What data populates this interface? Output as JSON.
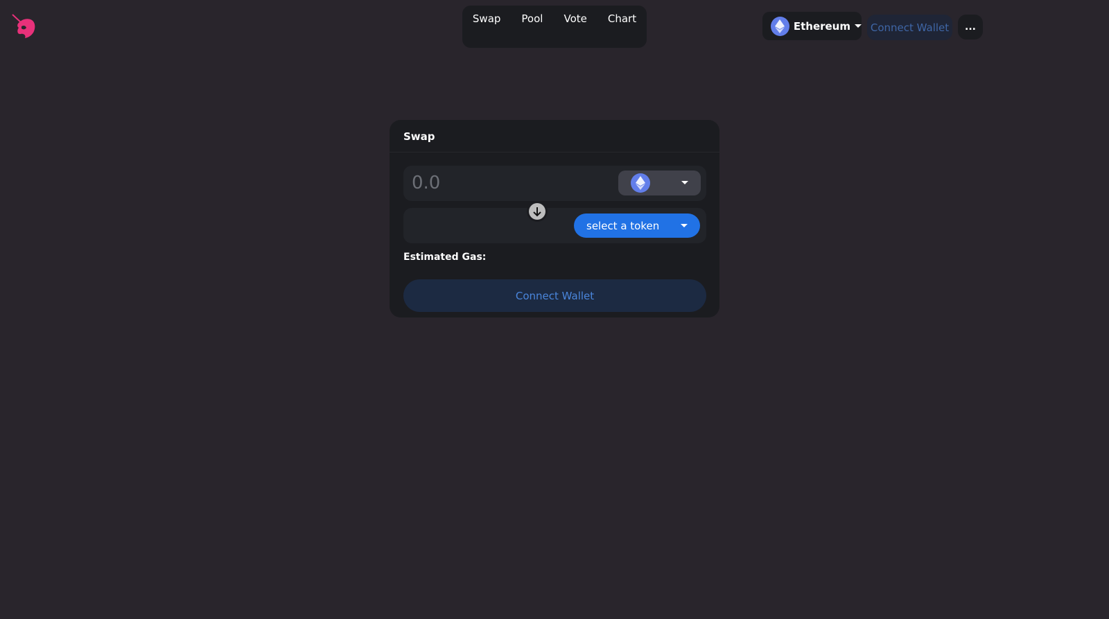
{
  "header": {
    "logo_alt": "Uniswap",
    "nav": [
      {
        "label": "Swap"
      },
      {
        "label": "Pool"
      },
      {
        "label": "Vote"
      },
      {
        "label": "Chart"
      }
    ],
    "network": {
      "label": "Ethereum",
      "icon": "ethereum-icon"
    },
    "connect_wallet": "Connect Wallet",
    "more": "..."
  },
  "swap": {
    "title": "Swap",
    "input_placeholder": "0.0",
    "input_token_icon": "ethereum-icon",
    "output_token_label": "select a token",
    "estimated_gas_label": "Estimated Gas:",
    "connect_wallet": "Connect Wallet"
  },
  "colors": {
    "background": "#29252c",
    "card": "#1b1c20",
    "accent": "#2172e5",
    "brand": "#ff007a",
    "ethereum": "#627eea"
  }
}
